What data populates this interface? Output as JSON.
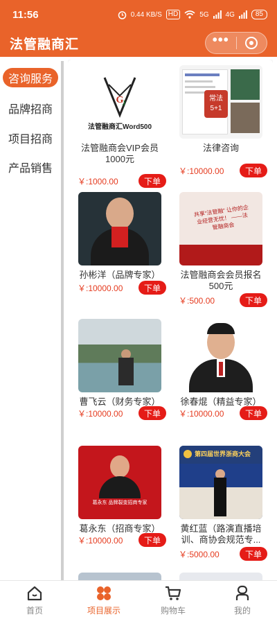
{
  "status_bar": {
    "time": "11:56",
    "network_speed": "0.44 KB/S",
    "hd": "HD",
    "signal1": "5G",
    "signal2": "4G",
    "battery": "85"
  },
  "nav": {
    "title": "法管融商汇"
  },
  "sidebar": {
    "items": [
      {
        "label": "咨询服务",
        "active": true
      },
      {
        "label": "品牌招商",
        "active": false
      },
      {
        "label": "项目招商",
        "active": false
      },
      {
        "label": "产品销售",
        "active": false
      }
    ]
  },
  "products": [
    {
      "name": "法管融商会VIP会员1000元",
      "price": "￥:1000.00",
      "buy": "下单",
      "thumb_caption": "法管融商汇Word500"
    },
    {
      "name": "法律咨询",
      "price": "￥:10000.00",
      "buy": "下单",
      "thumb_caption": "常法 5+1"
    },
    {
      "name": "孙彬洋（品牌专家）",
      "price": "￥:10000.00",
      "buy": "下单"
    },
    {
      "name": "法管融商会会员报名500元",
      "price": "￥:500.00",
      "buy": "下单",
      "thumb_caption": "共享“法管融” 让你的企业经营无忧！ ——法管融商会"
    },
    {
      "name": "曹飞云（财务专家）",
      "price": "￥:10000.00",
      "buy": "下单"
    },
    {
      "name": "徐春焜（精益专家）",
      "price": "￥:10000.00",
      "buy": "下单"
    },
    {
      "name": "葛永东（招商专家）",
      "price": "￥:10000.00",
      "buy": "下单",
      "thumb_caption": "葛永东 品牌裂变招商专家"
    },
    {
      "name": "黄红蓝（路演直播培训、商协会规范专...",
      "price": "￥:5000.00",
      "buy": "下单",
      "thumb_caption": "第四届世界浙商大会"
    }
  ],
  "tabbar": {
    "items": [
      {
        "label": "首页",
        "active": false
      },
      {
        "label": "项目展示",
        "active": true
      },
      {
        "label": "购物车",
        "active": false
      },
      {
        "label": "我的",
        "active": false
      }
    ]
  },
  "colors": {
    "brand": "#e9632a",
    "price": "#e53b1f",
    "buy_button": "#e51c17"
  }
}
